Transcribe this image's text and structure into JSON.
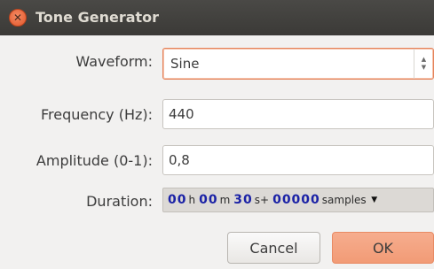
{
  "window": {
    "title": "Tone Generator"
  },
  "form": {
    "waveform": {
      "label": "Waveform:",
      "value": "Sine"
    },
    "frequency": {
      "label": "Frequency (Hz):",
      "value": "440"
    },
    "amplitude": {
      "label": "Amplitude (0-1):",
      "value": "0,8"
    },
    "duration": {
      "label": "Duration:",
      "hours": "00",
      "hours_unit": "h",
      "minutes": "00",
      "minutes_unit": "m",
      "seconds": "30",
      "seconds_unit": "s+",
      "samples": "00000",
      "samples_unit": "samples"
    }
  },
  "buttons": {
    "cancel": "Cancel",
    "ok": "OK"
  },
  "colors": {
    "titlebar": "#3b3a37",
    "close": "#e2572b",
    "ok": "#f29b76",
    "duration_digits": "#1b22a6"
  },
  "icons": {
    "close": "close-icon",
    "spin": "spin-arrows-icon",
    "dropdown": "dropdown-arrow-icon"
  }
}
